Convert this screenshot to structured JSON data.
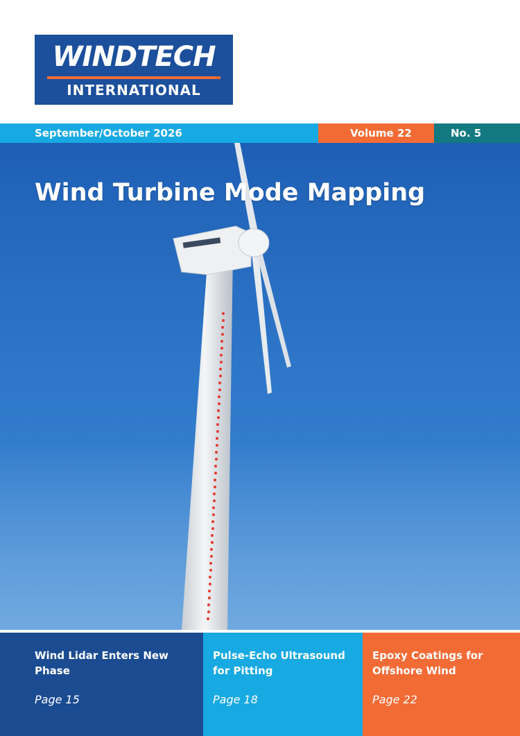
{
  "logo": {
    "line1": "WINDTECH",
    "line2": "INTERNATIONAL"
  },
  "issue": {
    "date": "September/October 2026",
    "volume": "Volume 22",
    "number": "No. 5"
  },
  "cover_title": "Wind Turbine Mode Mapping",
  "teasers": [
    {
      "title": "Wind Lidar Enters New Phase",
      "page": "Page 15"
    },
    {
      "title": "Pulse-Echo Ultrasound for Pitting",
      "page": "Page 18"
    },
    {
      "title": "Epoxy Coatings for Offshore Wind",
      "page": "Page 22"
    }
  ],
  "colors": {
    "brand_blue": "#1c4f9c",
    "cyan": "#17a9e1",
    "orange": "#f26b35",
    "teal": "#127a80",
    "navy": "#1b4c91"
  }
}
